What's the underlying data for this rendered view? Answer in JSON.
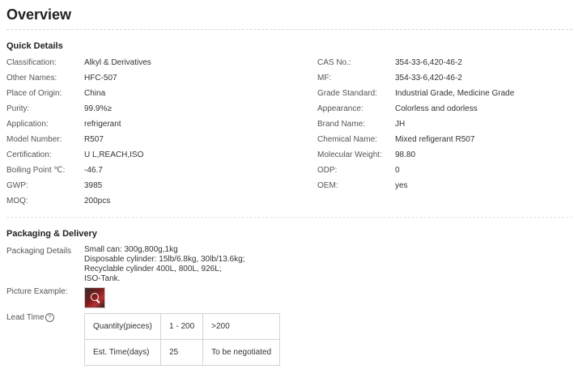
{
  "page": {
    "title": "Overview"
  },
  "quick_details": {
    "heading": "Quick Details",
    "left": [
      {
        "label": "Classification:",
        "value": "Alkyl & Derivatives"
      },
      {
        "label": "Other Names:",
        "value": "HFC-507"
      },
      {
        "label": "Place of Origin:",
        "value": "China"
      },
      {
        "label": "Purity:",
        "value": "99.9%≥"
      },
      {
        "label": "Application:",
        "value": "refrigerant"
      },
      {
        "label": "Model Number:",
        "value": "R507"
      },
      {
        "label": "Certification:",
        "value": "U L,REACH,ISO"
      },
      {
        "label": "Boiling Point ℃:",
        "value": "-46.7"
      },
      {
        "label": "GWP:",
        "value": "3985"
      },
      {
        "label": "MOQ:",
        "value": "200pcs"
      }
    ],
    "right": [
      {
        "label": "CAS No.:",
        "value": "354-33-6,420-46-2"
      },
      {
        "label": "MF:",
        "value": "354-33-6,420-46-2"
      },
      {
        "label": "Grade Standard:",
        "value": "Industrial Grade, Medicine Grade"
      },
      {
        "label": "Appearance:",
        "value": "Colorless and odorless"
      },
      {
        "label": "Brand Name:",
        "value": "JH"
      },
      {
        "label": "Chemical Name:",
        "value": "Mixed refigerant R507"
      },
      {
        "label": "Molecular Weight:",
        "value": "98.80"
      },
      {
        "label": "ODP:",
        "value": "0"
      },
      {
        "label": "OEM:",
        "value": "yes"
      }
    ]
  },
  "packaging": {
    "heading": "Packaging & Delivery",
    "details_label": "Packaging Details",
    "details_lines": [
      "Small can: 300g,800g,1kg",
      "Disposable cylinder: 15lb/6.8kg, 30lb/13.6kg;",
      "Recyclable cylinder 400L, 800L, 926L;",
      "ISO-Tank."
    ],
    "picture_label": "Picture Example:",
    "lead_time_label": "Lead Time",
    "lead_time_icon": "question-circle-icon",
    "lead_table": [
      [
        "Quantity(pieces)",
        "1 - 200",
        ">200"
      ],
      [
        "Est. Time(days)",
        "25",
        "To be negotiated"
      ]
    ]
  }
}
